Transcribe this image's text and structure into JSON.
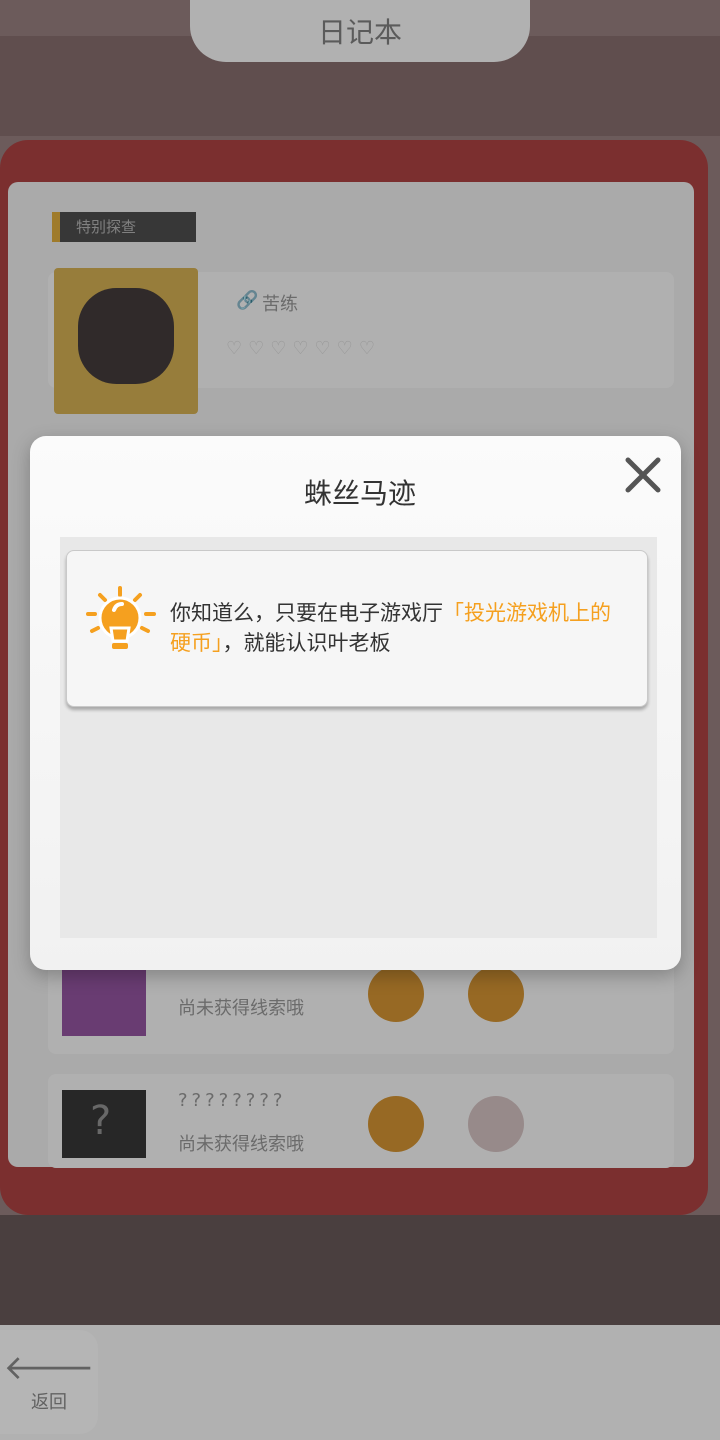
{
  "background": {
    "header_title": "日记本",
    "section_tag": "特别探查",
    "entry1_name": "苦练",
    "row2_text": "尚未获得线索哦",
    "row3_name": "????????",
    "row3_text": "尚未获得线索哦",
    "back_arrow": "🡐",
    "back_label": "返回"
  },
  "modal": {
    "title": "蛛丝马迹",
    "close_icon": "close-icon",
    "hint_icon": "lightbulb-icon",
    "hint_part1": "你知道么，只要在电子游戏厅",
    "hint_highlight": "「投光游戏机上的硬币」",
    "hint_part2": "，就能认识叶老板",
    "highlight_color": "#f5a01f"
  }
}
